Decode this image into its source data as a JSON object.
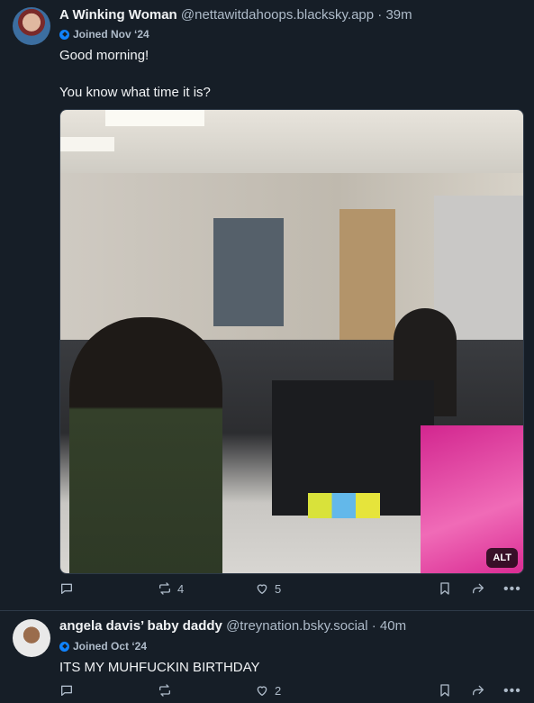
{
  "posts": [
    {
      "author_name": "A Winking Woman",
      "handle": "@nettawitdahoops.blacksky.app",
      "time": "· 39m",
      "joined": "Joined Nov ‘24",
      "text_lines": [
        "Good morning!",
        "You know what time it is?"
      ],
      "media_alt_badge": "ALT",
      "reply_count": "",
      "repost_count": "4",
      "like_count": "5"
    },
    {
      "author_name": "angela davis’ baby daddy",
      "handle": "@treynation.bsky.social",
      "time": "· 40m",
      "joined": "Joined Oct ‘24",
      "text_lines": [
        "ITS MY MUHFUCKIN BIRTHDAY"
      ],
      "reply_count": "",
      "repost_count": "",
      "like_count": "2"
    }
  ],
  "icons": {
    "reply": "reply-icon",
    "repost": "repost-icon",
    "like": "heart-icon",
    "save": "bookmark-icon",
    "share": "share-icon",
    "more": "more-icon",
    "badge": "verified-badge-icon"
  },
  "colors": {
    "background": "#161e27",
    "text": "#f1f3f5",
    "muted": "#aebbc9",
    "accent": "#1083fe"
  }
}
